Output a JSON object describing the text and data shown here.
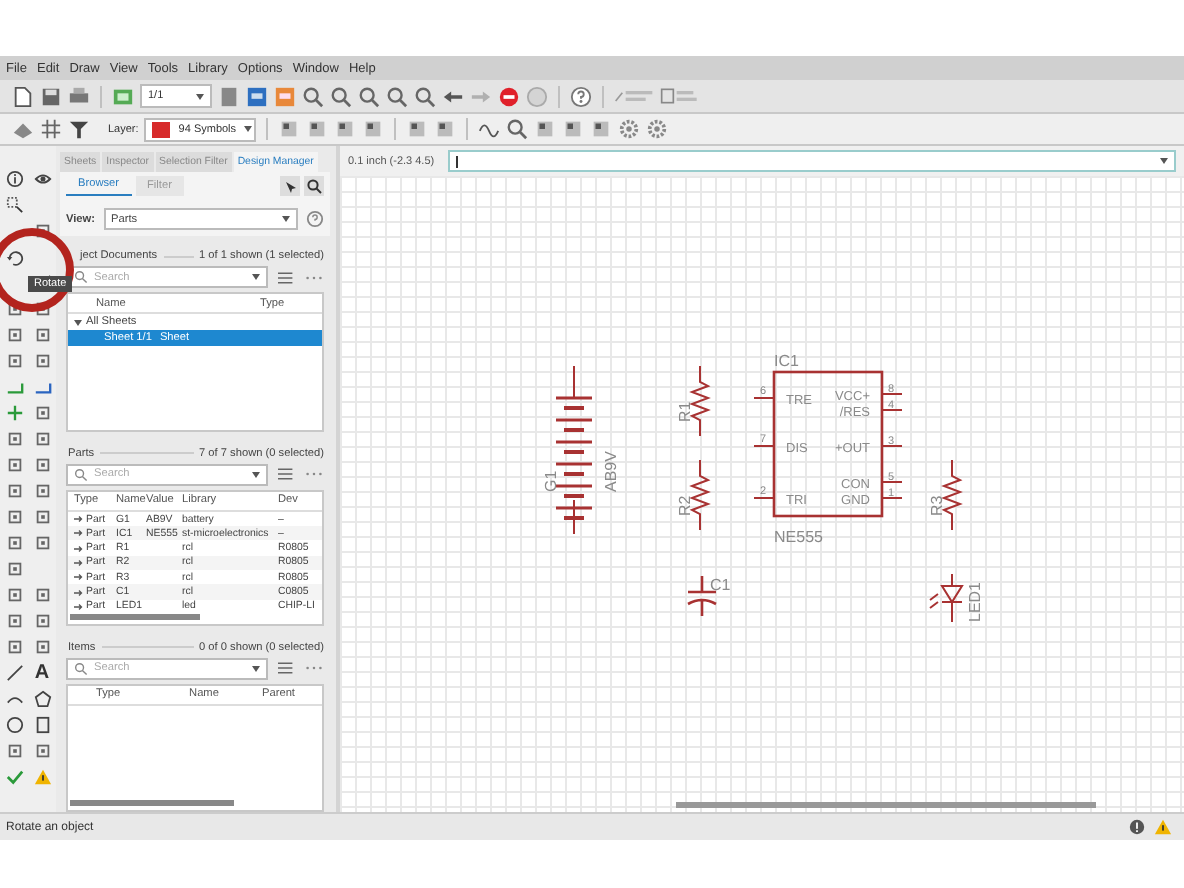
{
  "menu": [
    "File",
    "Edit",
    "Draw",
    "View",
    "Tools",
    "Library",
    "Options",
    "Window",
    "Help"
  ],
  "toolbar": {
    "sheet_field": "1/1",
    "layer_label": "Layer:",
    "layer_value": "94 Symbols"
  },
  "panel_tabs": [
    {
      "label": "Sheets",
      "selected": false
    },
    {
      "label": "Inspector",
      "selected": false
    },
    {
      "label": "Selection Filter",
      "selected": false
    },
    {
      "label": "Design Manager",
      "selected": true
    }
  ],
  "browser_tabs": [
    {
      "label": "Browser",
      "selected": true
    },
    {
      "label": "Filter",
      "selected": false
    }
  ],
  "view": {
    "label": "View:",
    "value": "Parts"
  },
  "object_documents": {
    "title": "ject Documents",
    "count": "1 of 1 shown (1 selected)",
    "search_placeholder": "Search",
    "columns": [
      "Name",
      "Type"
    ],
    "tree": [
      {
        "label": "All Sheets",
        "expanded": true,
        "children": [
          {
            "name": "Sheet 1/1",
            "type": "Sheet",
            "selected": true
          }
        ]
      }
    ]
  },
  "parts": {
    "title": "Parts",
    "count": "7 of 7 shown (0 selected)",
    "search_placeholder": "Search",
    "columns": [
      "Type",
      "Name",
      "Value",
      "Library",
      "Dev"
    ],
    "rows": [
      {
        "type": "Part",
        "name": "G1",
        "value": "AB9V",
        "library": "battery",
        "device": "–"
      },
      {
        "type": "Part",
        "name": "IC1",
        "value": "NE555",
        "library": "st-microelectronics",
        "device": "–"
      },
      {
        "type": "Part",
        "name": "R1",
        "value": "",
        "library": "rcl",
        "device": "R0805"
      },
      {
        "type": "Part",
        "name": "R2",
        "value": "",
        "library": "rcl",
        "device": "R0805"
      },
      {
        "type": "Part",
        "name": "R3",
        "value": "",
        "library": "rcl",
        "device": "R0805"
      },
      {
        "type": "Part",
        "name": "C1",
        "value": "",
        "library": "rcl",
        "device": "C0805"
      },
      {
        "type": "Part",
        "name": "LED1",
        "value": "",
        "library": "led",
        "device": "CHIP-LI"
      }
    ]
  },
  "items": {
    "title": "Items",
    "count": "0 of 0 shown (0 selected)",
    "search_placeholder": "Search",
    "columns": [
      "Type",
      "Name",
      "Parent"
    ]
  },
  "tooltip": "Rotate",
  "text_tool_label": "A",
  "grid_readout": "0.1 inch (-2.3 4.5)",
  "schematic": {
    "parts": [
      {
        "kind": "battery",
        "name": "G1",
        "value": "AB9V"
      },
      {
        "kind": "resistor",
        "name": "R1"
      },
      {
        "kind": "resistor",
        "name": "R2"
      },
      {
        "kind": "capacitor",
        "name": "C1"
      },
      {
        "kind": "ic",
        "name": "IC1",
        "value": "NE555",
        "left_pins": [
          {
            "name": "TRE",
            "number": "6"
          },
          {
            "name": "DIS",
            "number": "7"
          },
          {
            "name": "TRI",
            "number": "2"
          }
        ],
        "right_pins": [
          {
            "name": "VCC+",
            "number": "8"
          },
          {
            "name": "/RES",
            "number": "4"
          },
          {
            "name": "+OUT",
            "number": "3"
          },
          {
            "name": "CON",
            "number": "5"
          },
          {
            "name": "GND",
            "number": "1"
          }
        ]
      },
      {
        "kind": "resistor",
        "name": "R3"
      },
      {
        "kind": "led",
        "name": "LED1"
      }
    ]
  },
  "status_bar": "Rotate an object"
}
